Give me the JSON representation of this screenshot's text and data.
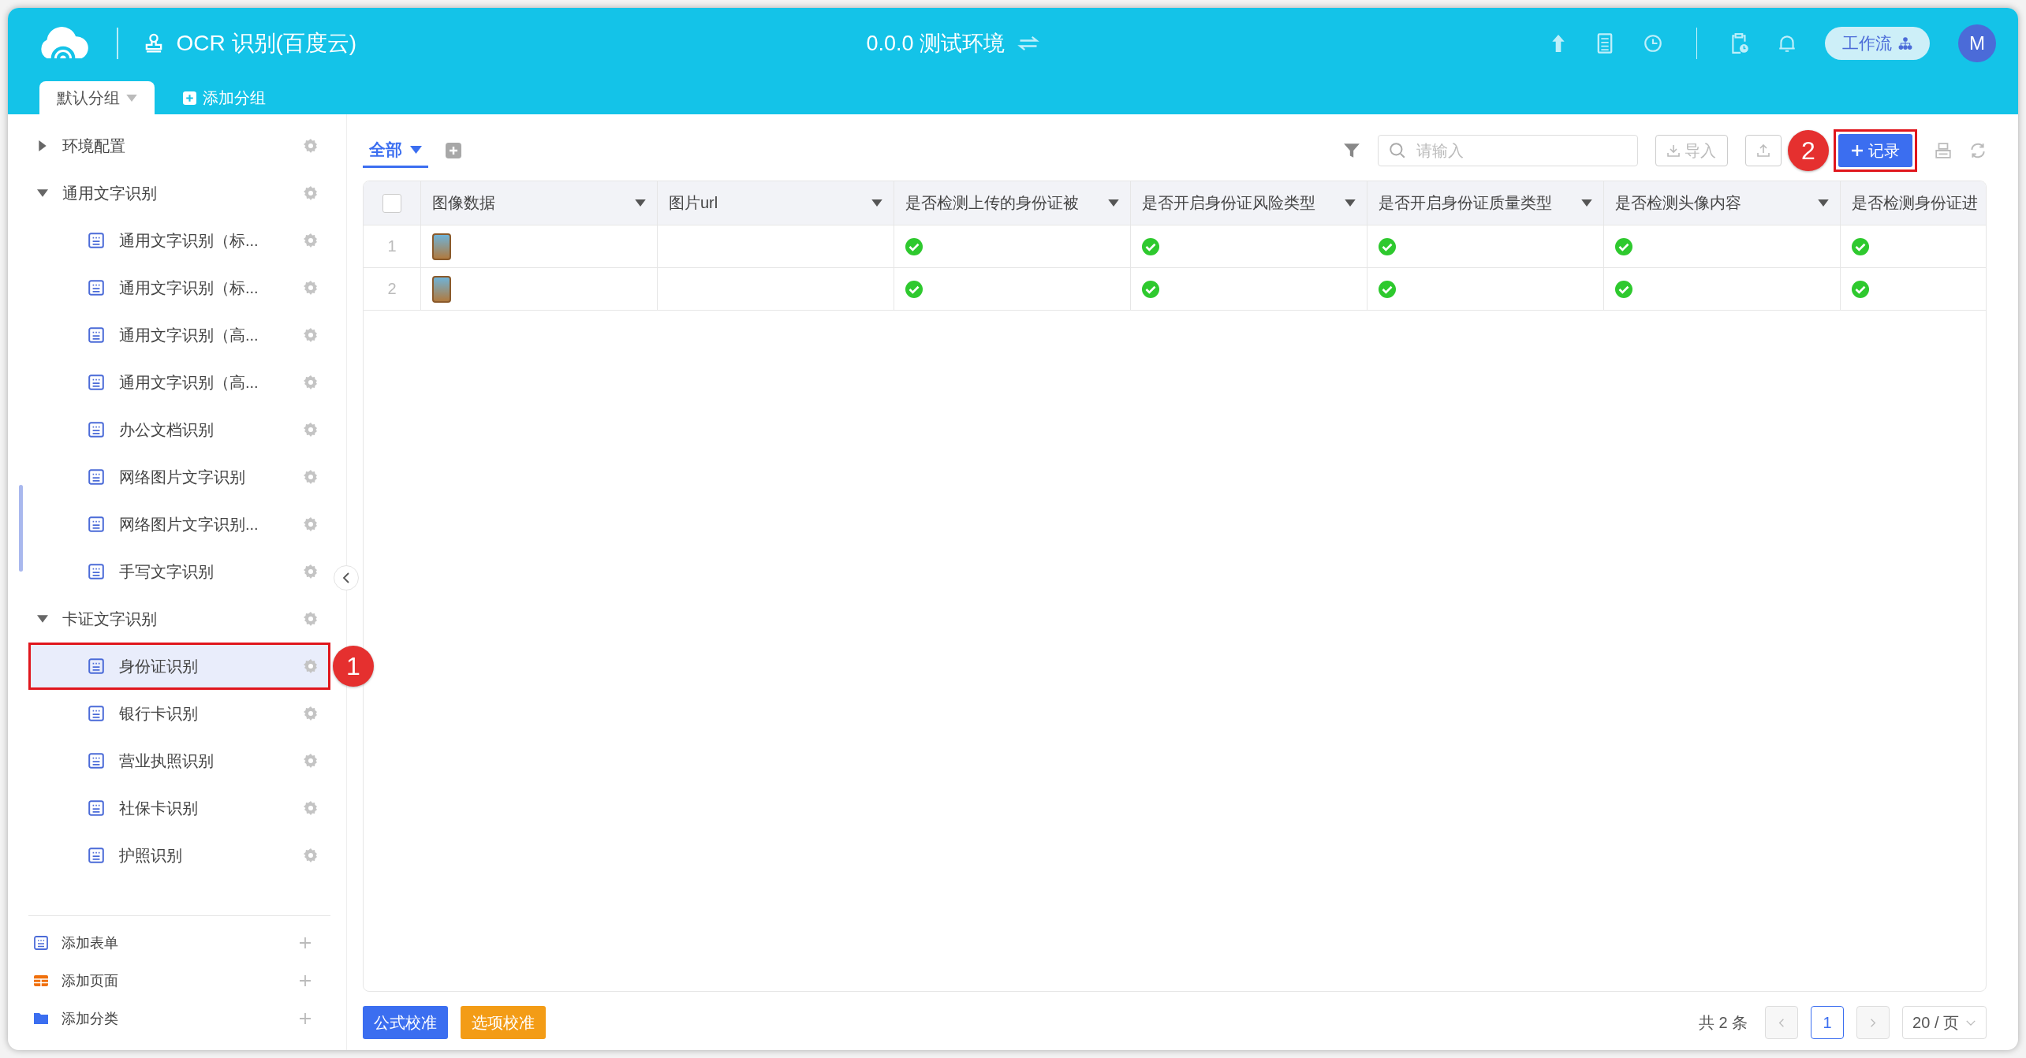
{
  "header": {
    "title": "OCR 识别(百度云)",
    "environment": "0.0.0 测试环境",
    "workflow_button": "工作流",
    "avatar": "M"
  },
  "group_tabs": [
    {
      "label": "默认分组",
      "selected": true,
      "kind": "group"
    },
    {
      "label": "添加分组",
      "selected": false,
      "kind": "add"
    }
  ],
  "sidebar": {
    "items": [
      {
        "label": "环境配置",
        "expanded": false,
        "selected": false
      },
      {
        "label": "通用文字识别",
        "expanded": true,
        "selected": false,
        "children": [
          {
            "label": "通用文字识别（标...",
            "selected": false
          },
          {
            "label": "通用文字识别（标...",
            "selected": false
          },
          {
            "label": "通用文字识别（高...",
            "selected": false
          },
          {
            "label": "通用文字识别（高...",
            "selected": false
          },
          {
            "label": "办公文档识别",
            "selected": false
          },
          {
            "label": "网络图片文字识别",
            "selected": false
          },
          {
            "label": "网络图片文字识别...",
            "selected": false
          },
          {
            "label": "手写文字识别",
            "selected": false
          }
        ]
      },
      {
        "label": "卡证文字识别",
        "expanded": true,
        "selected": false,
        "children": [
          {
            "label": "身份证识别",
            "selected": true,
            "annotation": "1"
          },
          {
            "label": "银行卡识别",
            "selected": false
          },
          {
            "label": "营业执照识别",
            "selected": false
          },
          {
            "label": "社保卡识别",
            "selected": false
          },
          {
            "label": "护照识别",
            "selected": false
          }
        ]
      }
    ],
    "actions": [
      {
        "label": "添加表单",
        "kind": "form"
      },
      {
        "label": "添加页面",
        "kind": "page"
      },
      {
        "label": "添加分类",
        "kind": "folder"
      }
    ]
  },
  "view_tabs": [
    {
      "label": "全部",
      "selected": true
    }
  ],
  "toolbar": {
    "search_placeholder": "请输入",
    "import_button": "导入",
    "add_button": "记录",
    "add_button_annotation": "2"
  },
  "table": {
    "columns": [
      "图像数据",
      "图片url",
      "是否检测上传的身份证被",
      "是否开启身份证风险类型",
      "是否开启身份证质量类型",
      "是否检测头像内容",
      "是否检测身份证进"
    ],
    "select_all": {
      "checked": false
    },
    "rows": [
      {
        "index": "1",
        "checks": [
          true,
          true,
          true,
          true,
          true
        ]
      },
      {
        "index": "2",
        "checks": [
          true,
          true,
          true,
          true,
          true
        ]
      }
    ]
  },
  "footer": {
    "buttons": [
      {
        "label": "公式校准",
        "kind": "primary"
      },
      {
        "label": "选项校准",
        "kind": "warning"
      }
    ],
    "total": "共 2 条",
    "pages": [
      {
        "label": "1",
        "selected": true
      }
    ],
    "page_size": "20 / 页"
  }
}
